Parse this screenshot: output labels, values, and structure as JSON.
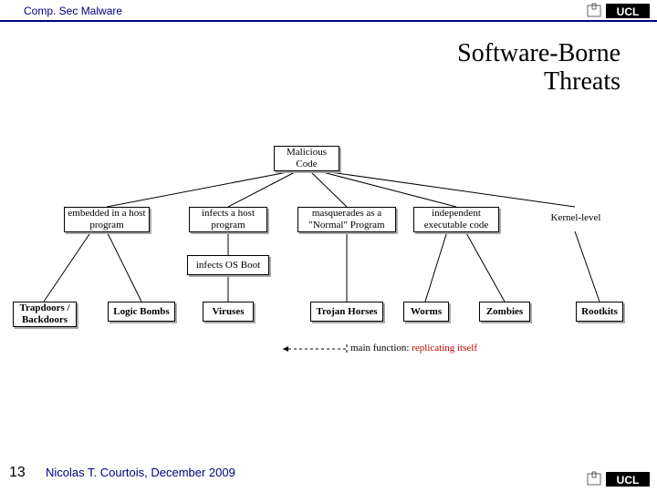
{
  "breadcrumb": "Comp. Sec Malware",
  "title_line1": "Software-Borne",
  "title_line2": "Threats",
  "root": "Malicious Code",
  "mid": {
    "embedded": "embedded in a host program",
    "infects": "infects a host program",
    "masquerades": "masquerades as a \"Normal\" Program",
    "independent": "independent executable code",
    "kernel": "Kernel-level",
    "infects_boot": "infects OS Boot"
  },
  "leaves": {
    "trapdoors": "Trapdoors / Backdoors",
    "logic": "Logic Bombs",
    "viruses": "Viruses",
    "trojan": "Trojan Horses",
    "worms": "Worms",
    "zombies": "Zombies",
    "rootkits": "Rootkits"
  },
  "replicating_prefix": "main function: ",
  "replicating_red": "replicating itself",
  "footer": {
    "page": "13",
    "text": "Nicolas T. Courtois, December 2009"
  },
  "logo_text": "UCL"
}
